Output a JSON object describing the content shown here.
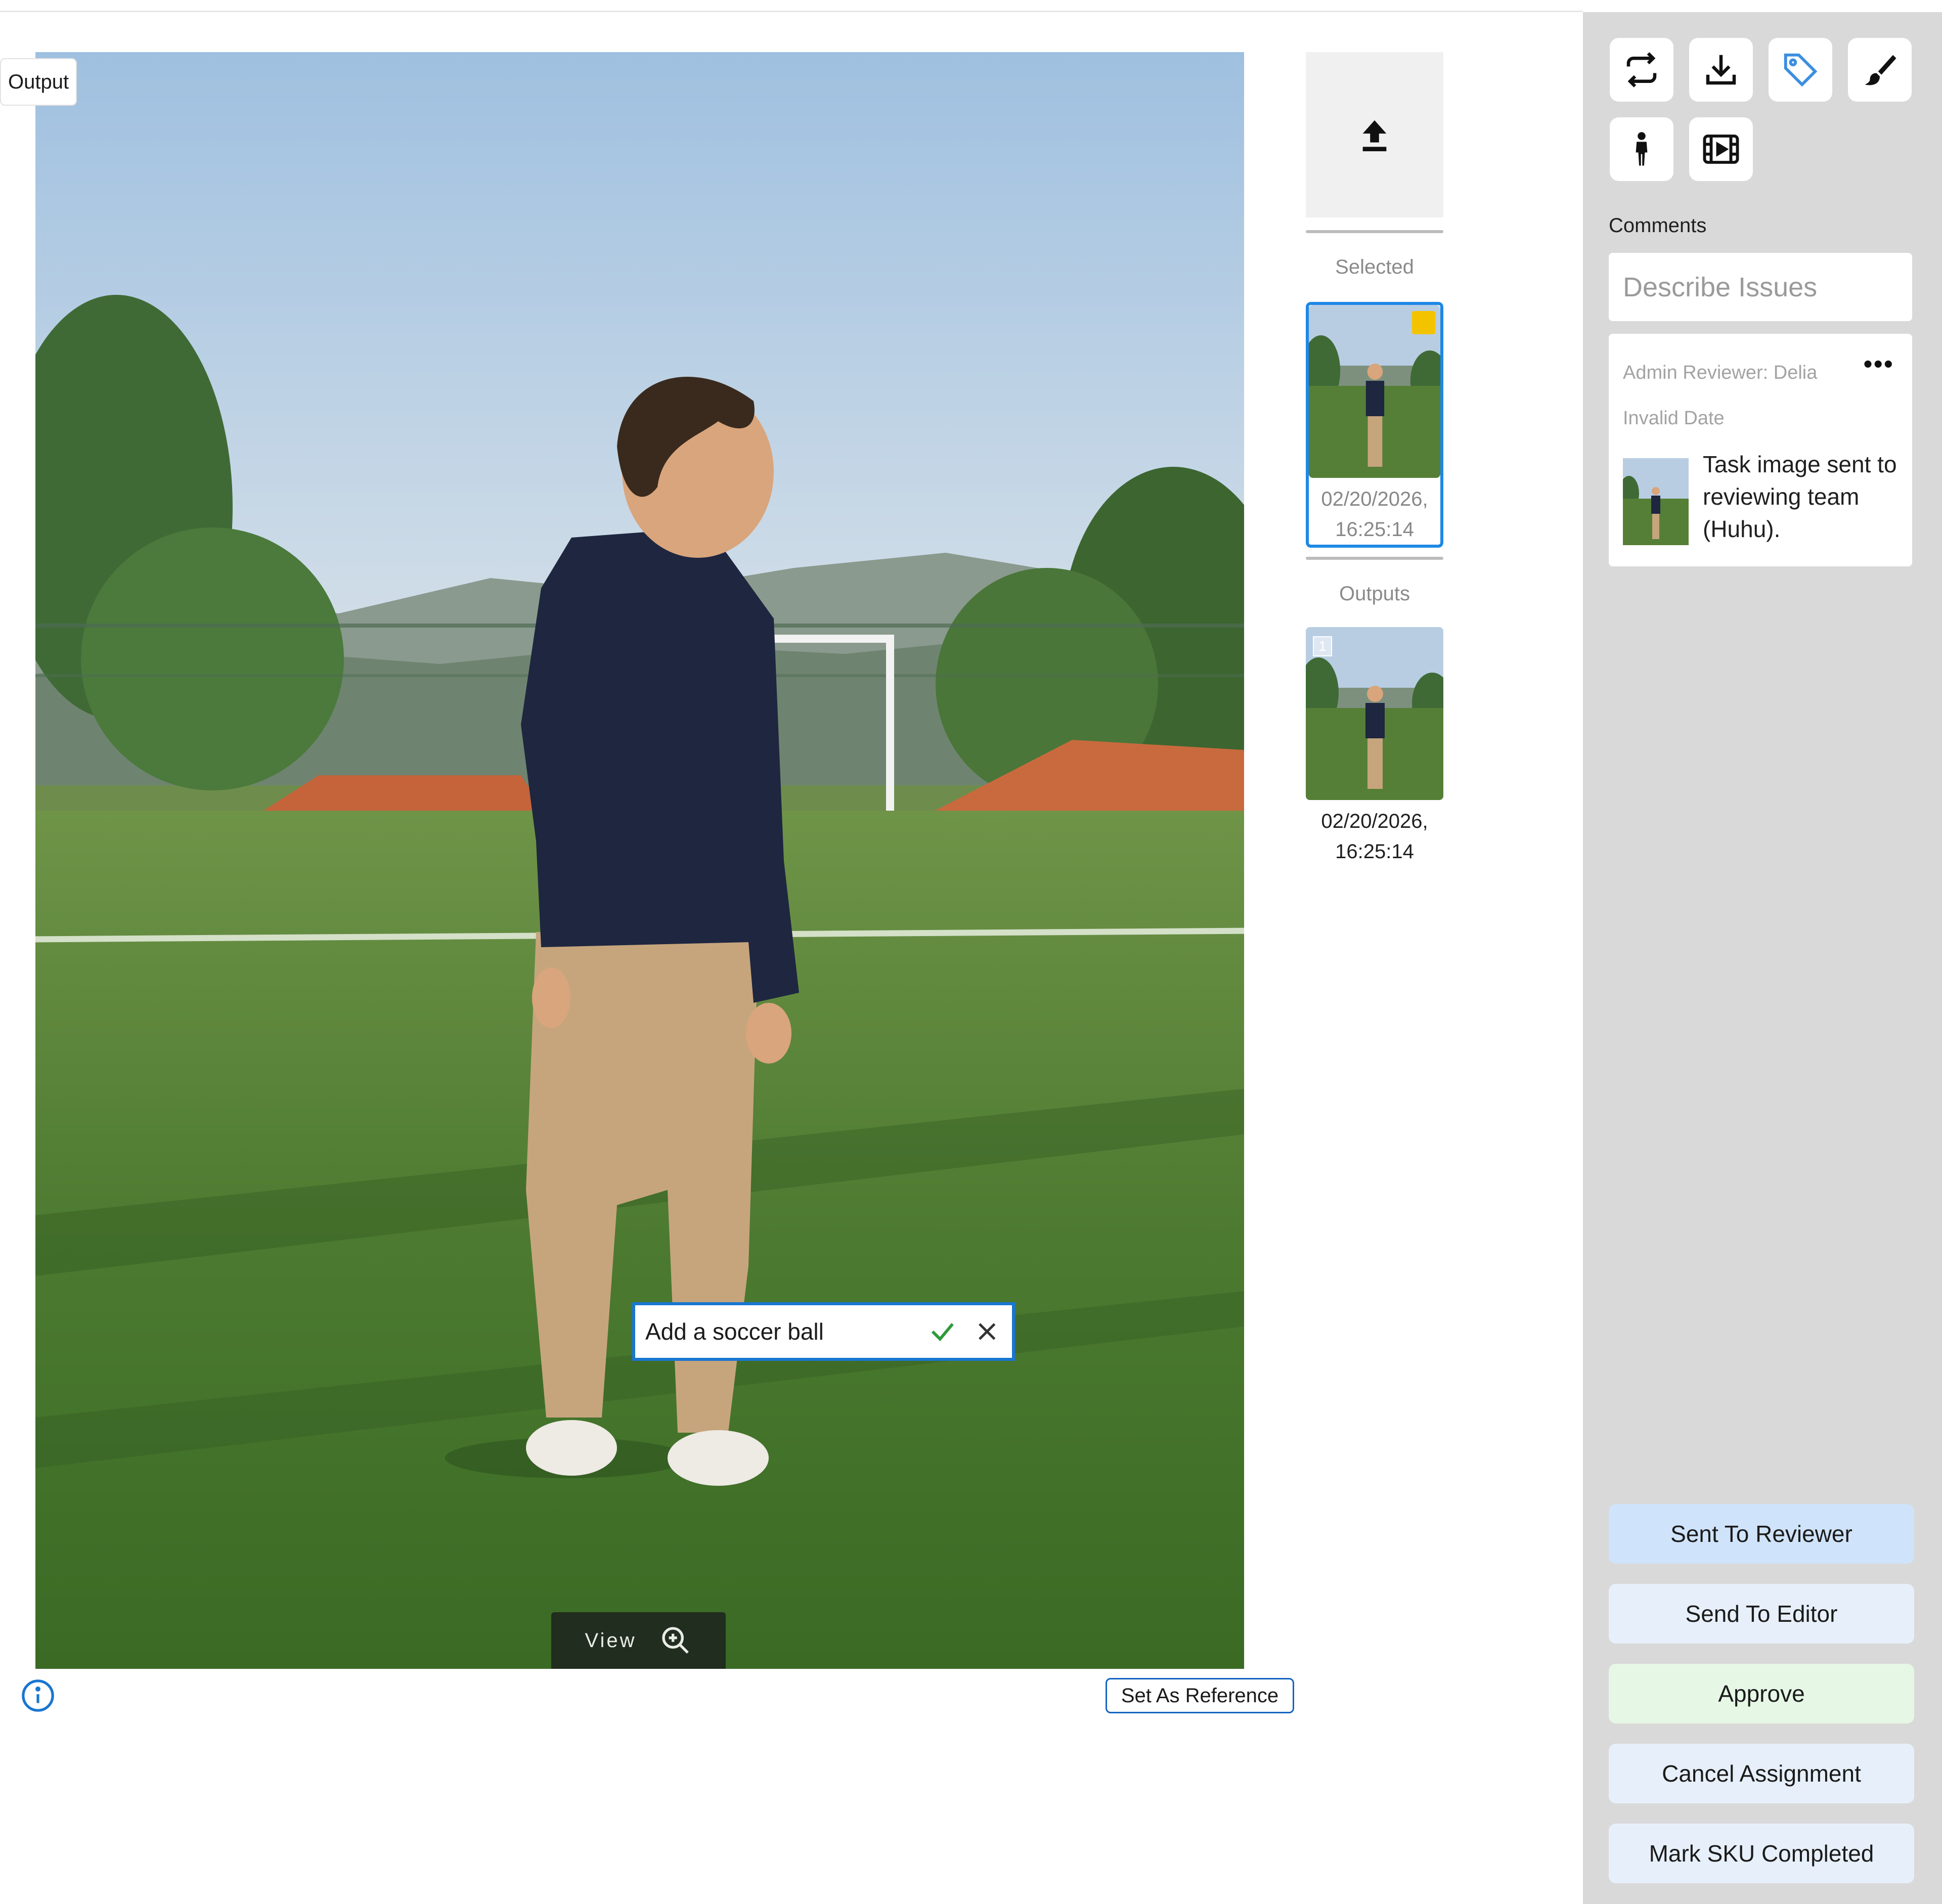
{
  "output_tag": "Output",
  "prompt": {
    "value": "Add a soccer ball",
    "confirm_icon": "check-icon",
    "cancel_icon": "close-icon"
  },
  "view_control": {
    "label": "View",
    "icon": "zoom-in-icon"
  },
  "set_reference_label": "Set As Reference",
  "thumbnails": {
    "upload_icon": "upload-icon",
    "selected_label": "Selected",
    "selected_date": "02/20/2026, 16:25:14",
    "outputs_label": "Outputs",
    "outputs": [
      {
        "number": "1",
        "date": "02/20/2026, 16:25:14"
      }
    ]
  },
  "toolbar": {
    "icons": [
      "swap-icon",
      "download-icon",
      "tag-icon",
      "brush-icon",
      "person-icon",
      "film-icon"
    ]
  },
  "comments": {
    "label": "Comments",
    "placeholder": "Describe Issues",
    "items": [
      {
        "author": "Admin Reviewer: Delia",
        "date": "Invalid Date",
        "text": "Task image sent to reviewing team (Huhu)."
      }
    ]
  },
  "actions": [
    {
      "label": "Sent To Reviewer",
      "color": "#cfe3fa"
    },
    {
      "label": "Send To Editor",
      "color": "#e7f0fa"
    },
    {
      "label": "Approve",
      "color": "#e6f7e6"
    },
    {
      "label": "Cancel Assignment",
      "color": "#e7f0fa"
    },
    {
      "label": "Mark SKU Completed",
      "color": "#e7f0fa"
    }
  ],
  "colors": {
    "accent": "#1976d2",
    "panel_bg": "#d9d9d9",
    "selected_badge": "#f4c300",
    "tag_icon": "#3b8fe0"
  }
}
